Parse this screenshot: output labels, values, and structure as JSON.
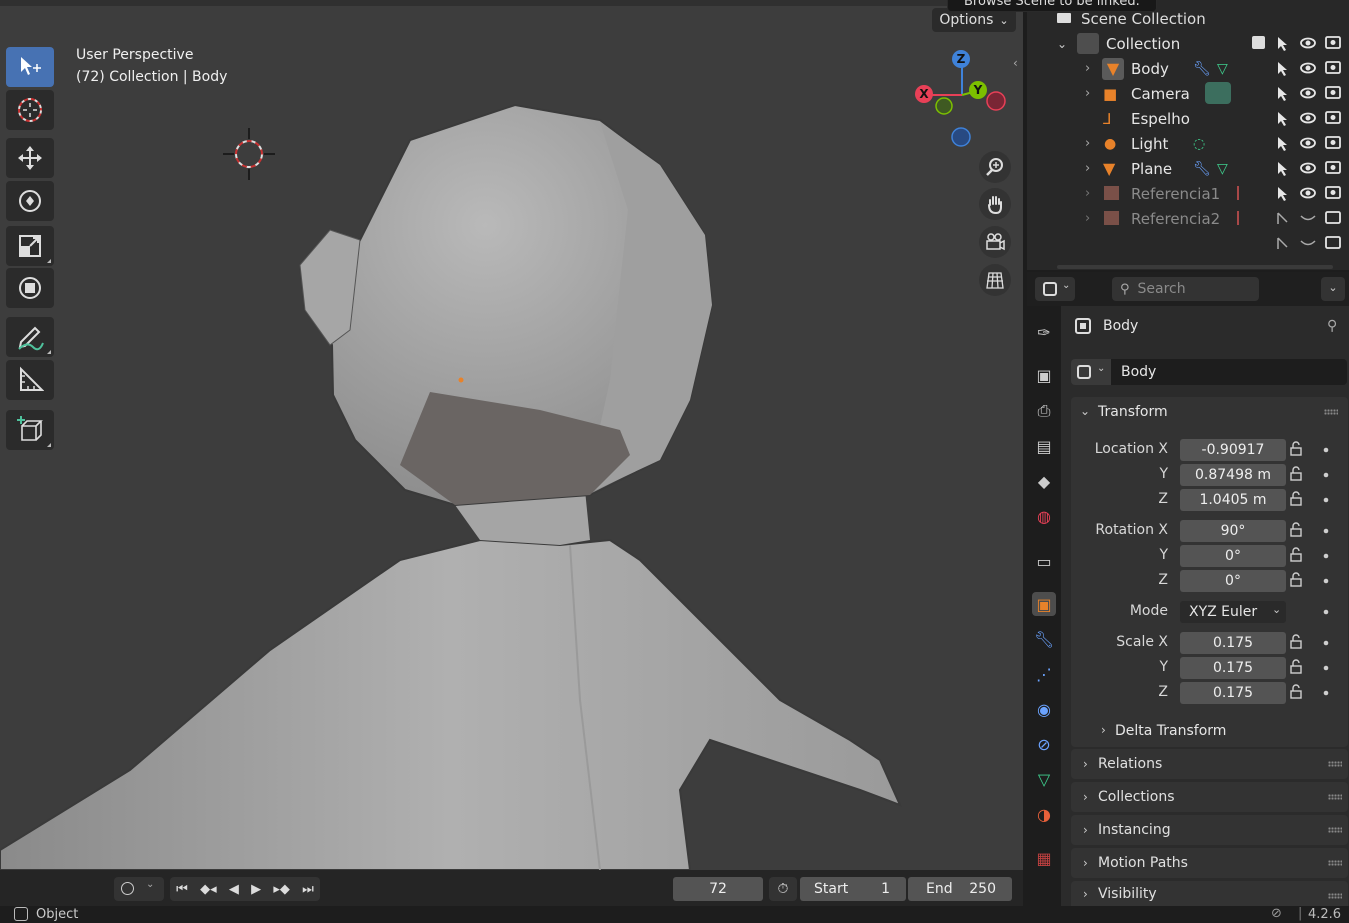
{
  "tooltip": "Browse Scene to be linked.",
  "viewport": {
    "perspective_label": "User Perspective",
    "collection_label": "(72) Collection | Body",
    "options_label": "Options",
    "gizmo_axes": {
      "x": "X",
      "y": "Y",
      "z": "Z"
    }
  },
  "toolbar": [
    "select-box",
    "cursor",
    "move",
    "rotate",
    "scale",
    "transform",
    "annotate",
    "measure",
    "add-cube"
  ],
  "outliner": {
    "scene_collection": "Scene Collection",
    "collection": "Collection",
    "items": [
      {
        "name": "Body",
        "dim": false
      },
      {
        "name": "Camera",
        "dim": false
      },
      {
        "name": "Espelho",
        "dim": false
      },
      {
        "name": "Light",
        "dim": false
      },
      {
        "name": "Plane",
        "dim": false
      },
      {
        "name": "Referencia1",
        "dim": true
      },
      {
        "name": "Referencia2",
        "dim": true
      }
    ]
  },
  "properties": {
    "search_placeholder": "Search",
    "object_title": "Body",
    "object_name": "Body",
    "transform_label": "Transform",
    "location_label": "Location X",
    "rotation_label": "Rotation X",
    "scale_label": "Scale X",
    "y_label": "Y",
    "z_label": "Z",
    "mode_label": "Mode",
    "location": {
      "x": "-0.90917",
      "y": "0.87498 m",
      "z": "1.0405 m"
    },
    "rotation": {
      "x": "90°",
      "y": "0°",
      "z": "0°"
    },
    "mode": "XYZ Euler",
    "scale": {
      "x": "0.175",
      "y": "0.175",
      "z": "0.175"
    },
    "delta_transform": "Delta Transform",
    "panels": [
      "Relations",
      "Collections",
      "Instancing",
      "Motion Paths",
      "Visibility"
    ]
  },
  "timeline": {
    "current_frame": "72",
    "start_label": "Start",
    "start_value": "1",
    "end_label": "End",
    "end_value": "250"
  },
  "status": {
    "mode": "Object",
    "version": "4.2.6"
  },
  "colors": {
    "accent": "#4772b3",
    "object_orange": "#e8822a",
    "x_axis": "#e84057",
    "y_axis": "#7cc000",
    "z_axis": "#3f82d9"
  }
}
